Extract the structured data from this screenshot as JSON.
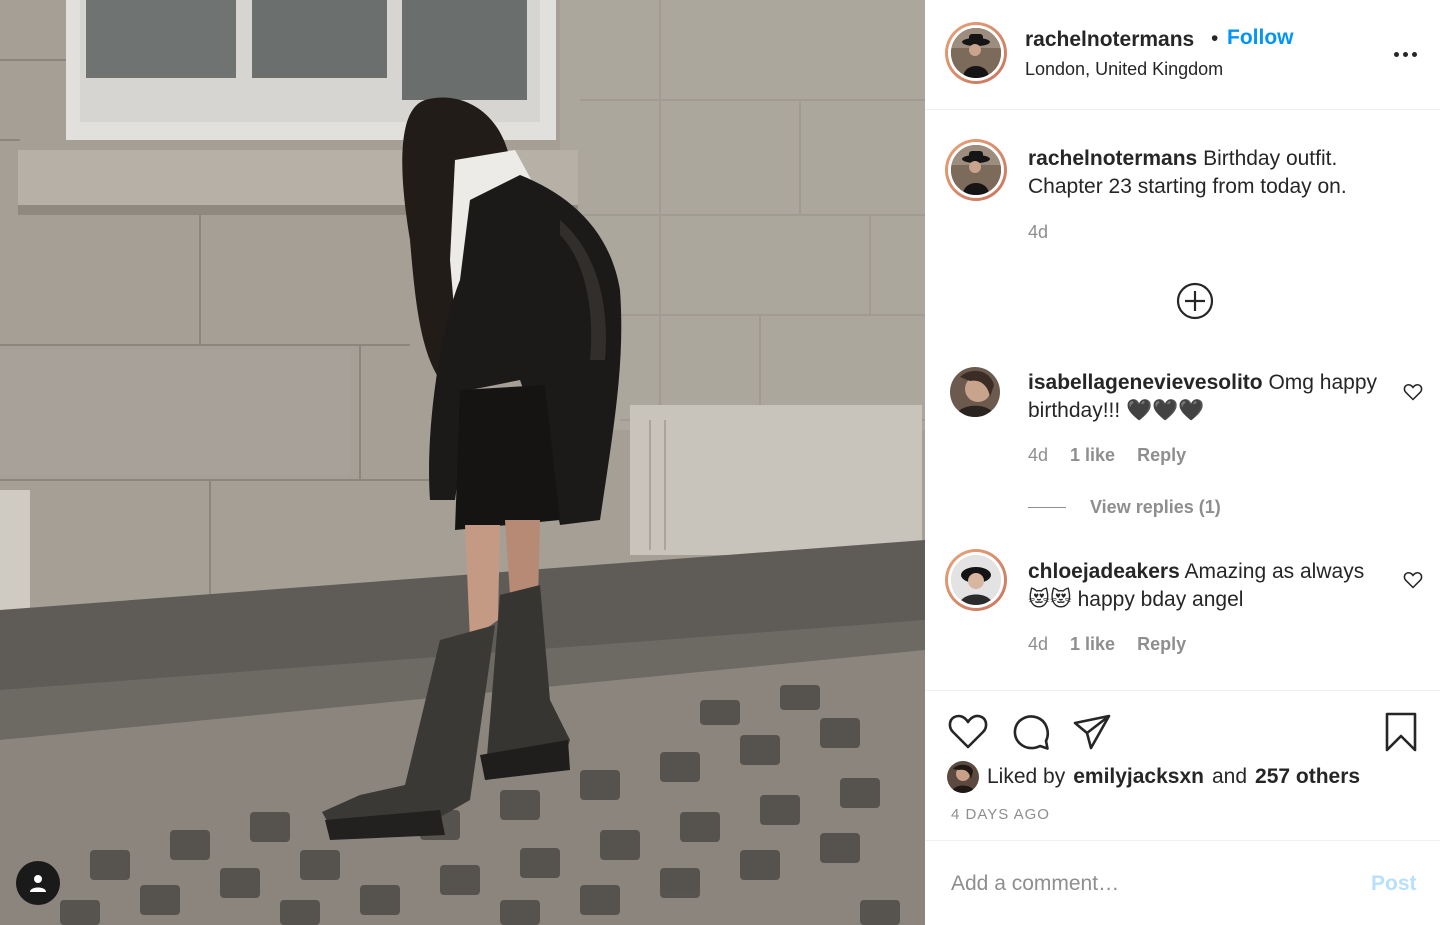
{
  "post": {
    "author": "rachelnotermans",
    "separator": "•",
    "follow_label": "Follow",
    "location": "London, United Kingdom"
  },
  "caption": {
    "username": "rachelnotermans",
    "text": "Birthday outfit. Chapter 23 starting from today on.",
    "time": "4d"
  },
  "comments": [
    {
      "username": "isabellagenevievesolito",
      "text": "Omg happy birthday!!! 🖤🖤🖤",
      "time": "4d",
      "likes": "1 like",
      "reply_label": "Reply",
      "view_replies": "View replies (1)"
    },
    {
      "username": "chloejadeakers",
      "text": "Amazing as always 😻😻 happy bday angel",
      "time": "4d",
      "likes": "1 like",
      "reply_label": "Reply"
    }
  ],
  "likes": {
    "prefix": "Liked by",
    "user": "emilyjacksxn",
    "joiner": "and",
    "others": "257 others"
  },
  "timestamp": "4 DAYS AGO",
  "comment_box": {
    "placeholder": "Add a comment…",
    "post_label": "Post"
  },
  "colors": {
    "link_blue": "#0095f6",
    "muted": "#8e8e8e",
    "post_disabled": "#b9dffc",
    "avatar_ring": "#d68464"
  },
  "icons": {
    "more": "more-options-icon",
    "load_more": "plus-circle-icon",
    "like": "heart-icon",
    "comment": "comment-bubble-icon",
    "share": "paper-plane-icon",
    "save": "bookmark-icon",
    "tag": "user-tag-icon"
  }
}
